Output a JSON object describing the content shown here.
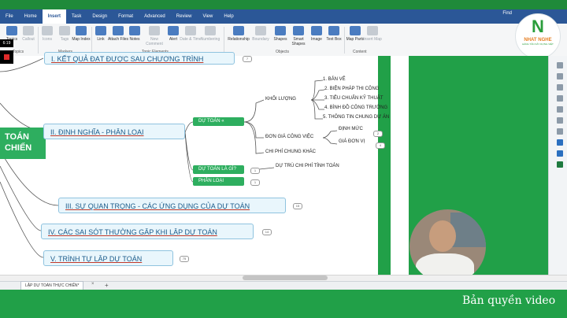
{
  "ribbon_tabs": [
    "File",
    "Home",
    "Insert",
    "Task",
    "Design",
    "Format",
    "Advanced",
    "Review",
    "View",
    "Help"
  ],
  "active_tab": "Insert",
  "find_label": "Find",
  "ribbon_buttons": [
    {
      "label": "Topics",
      "disabled": false
    },
    {
      "label": "Callout",
      "disabled": true
    },
    {
      "label": "Icons",
      "disabled": true
    },
    {
      "label": "Tags",
      "disabled": true
    },
    {
      "label": "Map Index",
      "disabled": false
    },
    {
      "label": "Link",
      "disabled": false
    },
    {
      "label": "Attach Files",
      "disabled": false
    },
    {
      "label": "Notes",
      "disabled": false
    },
    {
      "label": "New Comment",
      "disabled": true
    },
    {
      "label": "Alert",
      "disabled": false
    },
    {
      "label": "Date & Time",
      "disabled": true
    },
    {
      "label": "Numbering",
      "disabled": true
    },
    {
      "label": "Relationship",
      "disabled": false
    },
    {
      "label": "Boundary",
      "disabled": true
    },
    {
      "label": "Shapes",
      "disabled": false
    },
    {
      "label": "Smart Shapes",
      "disabled": false
    },
    {
      "label": "Image",
      "disabled": false
    },
    {
      "label": "Text Box",
      "disabled": false
    },
    {
      "label": "Map Parts",
      "disabled": false
    },
    {
      "label": "Insert Map",
      "disabled": true
    }
  ],
  "ribbon_groups": [
    "Topics",
    "Markers",
    "Topic Elements",
    "Objects",
    "Content"
  ],
  "logo": {
    "mark": "N",
    "title": "NHAT NGHE",
    "subtitle": "HÀNG TÂN XÂY DỰNG VIỆT"
  },
  "recording": {
    "timer": "6:19"
  },
  "mindmap": {
    "root": "TOÁN CHIẾN",
    "topics": [
      {
        "label": "I. KẾT QUẢ ĐẠT ĐƯỢC SAU CHƯƠNG TRÌNH",
        "badge": "7"
      },
      {
        "label": "II. ĐỊNH NGHĨA - PHÂN LOẠI",
        "badge": ""
      },
      {
        "label": "III. SỰ QUAN TRỌNG - CÁC ỨNG DỤNG CỦA DỰ TOÁN",
        "badge": "15"
      },
      {
        "label": "IV. CÁC SAI SÓT THƯỜNG GẶP KHI LẬP DỰ TOÁN",
        "badge": "14"
      },
      {
        "label": "V. TRÌNH TỰ LẬP DỰ TOÁN",
        "badge": "75"
      }
    ],
    "subtopics": [
      {
        "label": "DỰ TOÁN «",
        "badge": ""
      },
      {
        "label": "DỰ TOÁN LÀ GÌ?",
        "badge": ""
      },
      {
        "label": "PHÂN LOẠI",
        "badge": "1"
      }
    ],
    "leaves": {
      "khoi_luong": "KHỐI LƯỢNG",
      "don_gia": "ĐƠN GIÁ CÔNG VIỆC",
      "chi_phi": "CHI PHÍ CHUNG KHÁC",
      "du_tru": "DỰ TRÙ CHI PHÍ TÍNH TOÁN",
      "dinh_muc": "ĐỊNH MỨC",
      "gia_don_vi": "GIÁ ĐƠN VỊ",
      "kl_items": [
        "1. BẢN VẼ",
        "2. BIỆN PHÁP THI CÔNG",
        "3. TIÊU CHUẨN KỸ THUẬT",
        "4. BÌNH ĐỒ CÔNG TRƯỜNG",
        "5. THÔNG TIN CHUNG DỰ ÁN"
      ],
      "badges": {
        "don_gia": "2",
        "gia_don_vi": "4",
        "du_toan_la_gi": "1"
      }
    }
  },
  "document_tab": "LẬP DỰ TOÁN THỰC CHIẾN*",
  "copyright": "Bản quyền video"
}
